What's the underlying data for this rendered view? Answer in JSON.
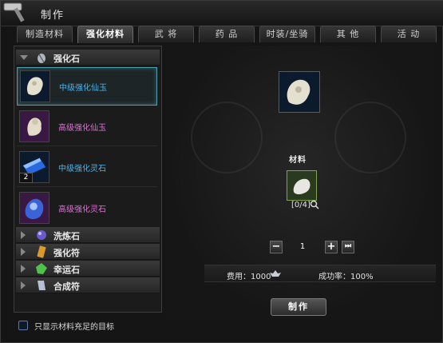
{
  "window": {
    "title": "制作"
  },
  "tabs": [
    {
      "label": "制造材料"
    },
    {
      "label": "强化材料",
      "active": true
    },
    {
      "label": "武 将"
    },
    {
      "label": "药 品"
    },
    {
      "label": "时装/坐骑"
    },
    {
      "label": "其 他"
    },
    {
      "label": "活 动"
    }
  ],
  "sidebar": {
    "groups": [
      {
        "label": "强化石",
        "icon": "feather-stone-icon",
        "expanded": true
      },
      {
        "label": "洗炼石",
        "icon": "purple-orb-icon",
        "expanded": false
      },
      {
        "label": "强化符",
        "icon": "gold-talisman-icon",
        "expanded": false
      },
      {
        "label": "幸运石",
        "icon": "green-gem-icon",
        "expanded": false
      },
      {
        "label": "合成符",
        "icon": "scroll-icon",
        "expanded": false
      }
    ],
    "items": [
      {
        "label": "中级强化仙玉",
        "color": "#4fb2e8",
        "icon": "white-jade-icon",
        "selected": true
      },
      {
        "label": "高级强化仙玉",
        "color": "#e070d8",
        "icon": "jade-figure-icon"
      },
      {
        "label": "中级强化灵石",
        "color": "#4fb2e8",
        "icon": "blue-spirit-stone-icon",
        "count": "2"
      },
      {
        "label": "高级强化灵石",
        "color": "#e070d8",
        "icon": "purple-spirit-stone-icon"
      }
    ]
  },
  "filter": {
    "label": "只显示材料充足的目标",
    "checked": false
  },
  "craft": {
    "material_label": "材料",
    "material_count": "[0/4]",
    "quantity": "1",
    "decrease": "−",
    "increase": "+",
    "max": "⏭",
    "fee": "费用：1000",
    "success_rate": "成功率：100%",
    "button": "制作"
  }
}
